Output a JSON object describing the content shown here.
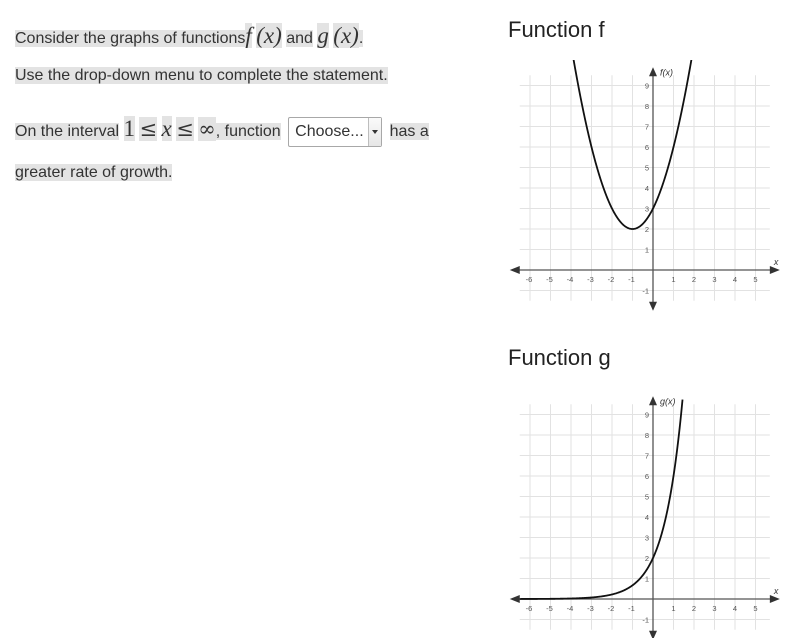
{
  "question": {
    "line1": {
      "prefix": "Consider the graphs of functions",
      "f": "f",
      "fx": "(x)",
      "and": "and",
      "g": "g",
      "gx": "(x)",
      "end": "."
    },
    "line2": "Use the drop-down menu to complete the statement.",
    "line3": {
      "prefix": "On the interval",
      "lower": "1",
      "le1": "≤",
      "var": "x",
      "le2": "≤",
      "upper": "∞",
      "mid": ", function",
      "suffix": "has a"
    },
    "line4": "greater rate of growth.",
    "dropdown": {
      "selected": "Choose..."
    }
  },
  "graphs": [
    {
      "title": "Function f",
      "ylabel": "f(x)",
      "xlabel": "x"
    },
    {
      "title": "Function g",
      "ylabel": "g(x)",
      "xlabel": "x"
    }
  ],
  "chart_data": [
    {
      "type": "line",
      "title": "Function f",
      "xlabel": "x",
      "ylabel": "f(x)",
      "xlim": [
        -6.5,
        5.7
      ],
      "ylim": [
        -1.5,
        9.5
      ],
      "x_ticks": [
        -6,
        -5,
        -4,
        -3,
        -2,
        -1,
        1,
        2,
        3,
        4,
        5
      ],
      "y_ticks": [
        -1,
        1,
        2,
        3,
        4,
        5,
        6,
        7,
        8,
        9
      ],
      "grid": true,
      "description": "parabola with vertex (-1, 2)",
      "series": [
        {
          "name": "f(x)",
          "x": [
            -3.9,
            -3.5,
            -3,
            -2.5,
            -2,
            -1.5,
            -1,
            -0.5,
            0,
            0.5,
            1,
            1.5,
            1.9
          ],
          "values": [
            10.41,
            8.25,
            6,
            4.25,
            3,
            2.25,
            2,
            2.25,
            3,
            4.25,
            6,
            8.25,
            10.41
          ]
        }
      ]
    },
    {
      "type": "line",
      "title": "Function g",
      "xlabel": "x",
      "ylabel": "g(x)",
      "xlim": [
        -6.5,
        5.7
      ],
      "ylim": [
        -1.5,
        9.5
      ],
      "x_ticks": [
        -6,
        -5,
        -4,
        -3,
        -2,
        -1,
        1,
        2,
        3,
        4,
        5
      ],
      "y_ticks": [
        -1,
        1,
        2,
        3,
        4,
        5,
        6,
        7,
        8,
        9
      ],
      "grid": true,
      "description": "exponential growth through (0, 2) and (1, 6)",
      "series": [
        {
          "name": "g(x)",
          "x": [
            -6.5,
            -5,
            -4,
            -3,
            -2,
            -1,
            -0.5,
            0,
            0.5,
            1,
            1.3,
            1.45
          ],
          "values": [
            0.002,
            0.008,
            0.025,
            0.074,
            0.222,
            0.667,
            1.155,
            2,
            3.464,
            6,
            8.38,
            9.78
          ]
        }
      ]
    }
  ]
}
